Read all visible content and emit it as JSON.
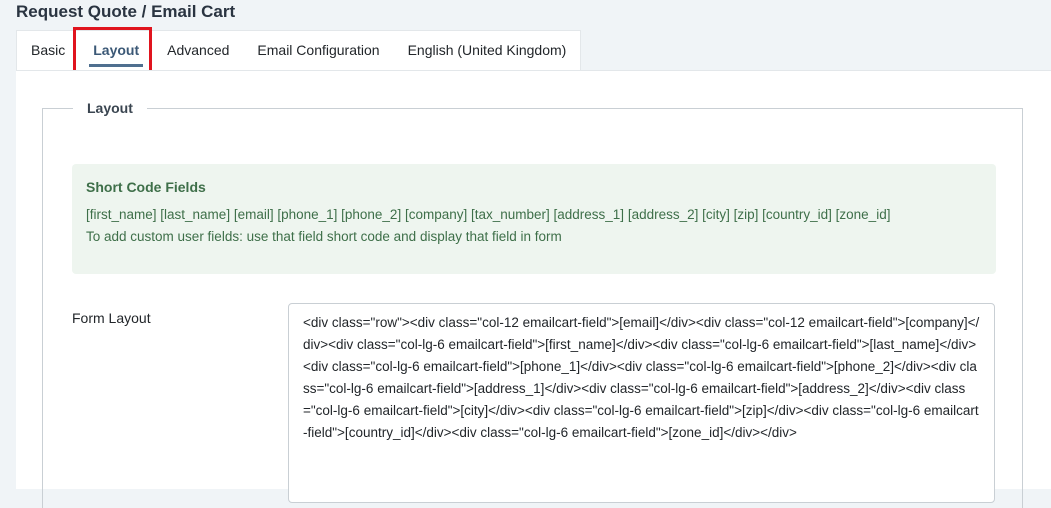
{
  "page": {
    "title": "Request Quote / Email Cart"
  },
  "tabs": [
    {
      "label": "Basic",
      "active": false
    },
    {
      "label": "Layout",
      "active": true
    },
    {
      "label": "Advanced",
      "active": false
    },
    {
      "label": "Email Configuration",
      "active": false
    },
    {
      "label": "English (United Kingdom)",
      "active": false
    }
  ],
  "fieldset": {
    "legend": "Layout"
  },
  "shortcodes": {
    "title": "Short Code Fields",
    "fields": "[first_name] [last_name] [email] [phone_1] [phone_2] [company] [tax_number] [address_1] [address_2] [city] [zip] [country_id] [zone_id]",
    "note": "To add custom user fields: use that field short code and display that field in form"
  },
  "form_layout": {
    "label": "Form Layout",
    "value": "<div class=\"row\"><div class=\"col-12 emailcart-field\">[email]</div><div class=\"col-12 emailcart-field\">[company]</div><div class=\"col-lg-6 emailcart-field\">[first_name]</div><div class=\"col-lg-6 emailcart-field\">[last_name]</div><div class=\"col-lg-6 emailcart-field\">[phone_1]</div><div class=\"col-lg-6 emailcart-field\">[phone_2]</div><div class=\"col-lg-6 emailcart-field\">[address_1]</div><div class=\"col-lg-6 emailcart-field\">[address_2]</div><div class=\"col-lg-6 emailcart-field\">[city]</div><div class=\"col-lg-6 emailcart-field\">[zip]</div><div class=\"col-lg-6 emailcart-field\">[country_id]</div><div class=\"col-lg-6 emailcart-field\">[zone_id]</div></div>"
  },
  "colors": {
    "highlight": "#e0141e",
    "active_tab": "#3b5876",
    "alert_bg": "#eef5ef",
    "alert_text": "#3e6f49"
  }
}
